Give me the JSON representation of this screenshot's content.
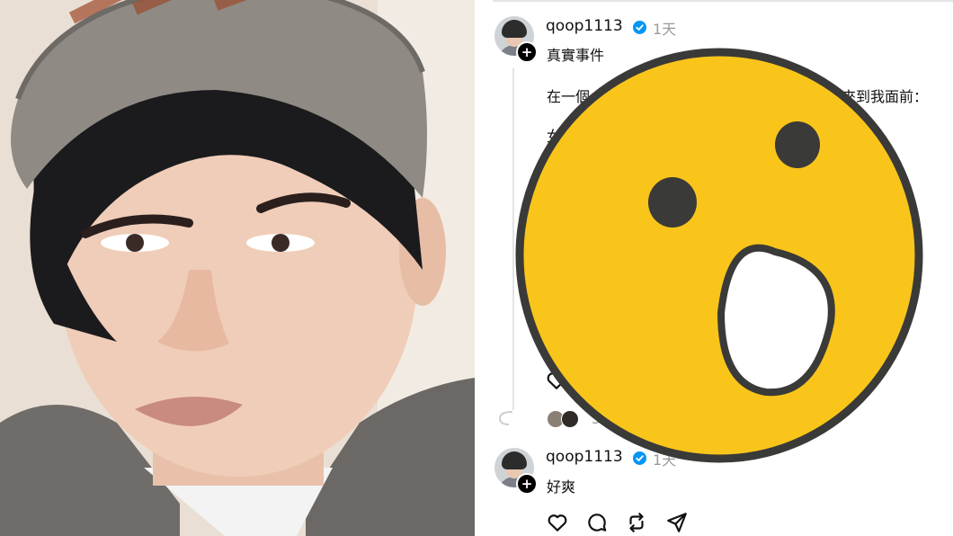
{
  "post": {
    "username": "qoop1113",
    "time": "1天",
    "title": "真實事件",
    "line1_left": "在一個",
    "line1_right": "子來到我面前：",
    "line2_fragment": "女"
  },
  "reply": {
    "username": "qoop1113",
    "time": "1天",
    "text": "好爽",
    "count_fragment": "3"
  },
  "icons": [
    "heart-icon",
    "comment-icon",
    "repost-icon",
    "share-icon",
    "verified-badge-icon",
    "plus-icon",
    "surprised-face-emoji"
  ],
  "colors": {
    "emoji_yellow": "#f9c51b",
    "emoji_outline": "#3a3a38",
    "verified_blue": "#0095f6"
  }
}
